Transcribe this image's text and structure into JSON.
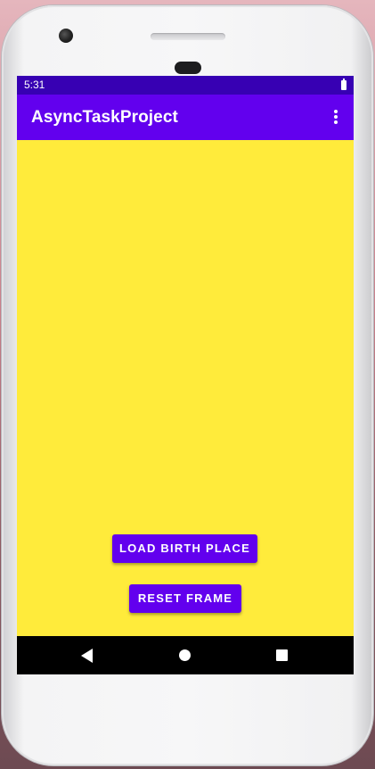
{
  "status_bar": {
    "time": "5:31",
    "battery_icon": "battery-full-icon"
  },
  "app_bar": {
    "title": "AsyncTaskProject",
    "menu_icon": "more-vert-icon"
  },
  "main": {
    "background_color": "#ffeb3b",
    "load_button_label": "LOAD BIRTH PLACE",
    "reset_button_label": "RESET FRAME"
  },
  "nav_bar": {
    "back_icon": "back-triangle-icon",
    "home_icon": "home-circle-icon",
    "recents_icon": "recents-square-icon"
  },
  "colors": {
    "primary": "#6200ee",
    "primary_dark": "#3700b3",
    "on_primary": "#ffffff"
  }
}
